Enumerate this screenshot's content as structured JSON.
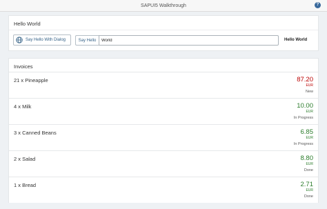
{
  "shell": {
    "title": "SAPUI5 Walkthrough"
  },
  "hello_panel": {
    "title": "Hello World",
    "dialog_button_label": "Say Hello With Dialog",
    "say_hello_label": "Say Hello",
    "name_input_value": "World",
    "output_text": "Hello World"
  },
  "invoices": {
    "title": "Invoices",
    "items": [
      {
        "title": "21 x Pineapple",
        "price": "87.20",
        "currency": "EUR",
        "status": "New",
        "state": "error"
      },
      {
        "title": "4 x Milk",
        "price": "10.00",
        "currency": "EUR",
        "status": "In Progress",
        "state": "success"
      },
      {
        "title": "3 x Canned Beans",
        "price": "6.85",
        "currency": "EUR",
        "status": "In Progress",
        "state": "success"
      },
      {
        "title": "2 x Salad",
        "price": "8.80",
        "currency": "EUR",
        "status": "Done",
        "state": "success"
      },
      {
        "title": "1 x Bread",
        "price": "2.71",
        "currency": "EUR",
        "status": "Done",
        "state": "success"
      }
    ]
  },
  "colors": {
    "error": "#bb0000",
    "success": "#2b7c2b",
    "link": "#346187"
  }
}
